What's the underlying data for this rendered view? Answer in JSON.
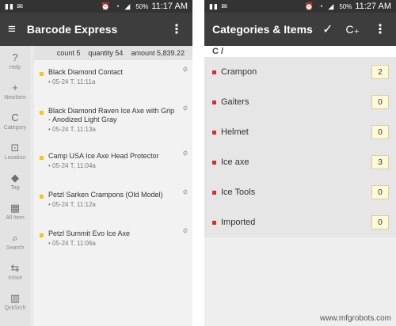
{
  "left": {
    "status": {
      "left_icons": "▮▮ ✉",
      "right_icons": "⏰ ◔ ◢",
      "battery": "50%",
      "time": "11:17 AM"
    },
    "appbar": {
      "title": "Barcode Express",
      "menu_icon": "≡",
      "overflow_icon": "⋮"
    },
    "sidebar": [
      {
        "label": "Help",
        "icon": "?"
      },
      {
        "label": "NewItem",
        "icon": "+"
      },
      {
        "label": "Category",
        "icon": "C"
      },
      {
        "label": "Location",
        "icon": "⊡"
      },
      {
        "label": "Tag",
        "icon": "◆"
      },
      {
        "label": "All Item",
        "icon": "▦"
      },
      {
        "label": "Search",
        "icon": "⌕"
      },
      {
        "label": "In/out",
        "icon": "⇆"
      },
      {
        "label": "QckSrch",
        "icon": "▥"
      }
    ],
    "summary": {
      "count": "count 5",
      "quantity": "quantity 54",
      "amount": "amount 5,839.22"
    },
    "items": [
      {
        "name": "Black Diamond Contact",
        "date": "• 05-24 T, 11:11a"
      },
      {
        "name": "Black Diamond Raven Ice Axe with Grip - Anodized Light Gray",
        "date": "• 05-24 T, 11:13a"
      },
      {
        "name": "Camp USA Ice Axe Head Protector",
        "date": "• 05-24 T, 11:04a"
      },
      {
        "name": "Petzl Sarken Crampons (Old Model)",
        "date": "• 05-24 T, 11:12a"
      },
      {
        "name": "Petzl Summit Evo Ice Axe",
        "date": "• 05-24 T, 11:06a"
      }
    ]
  },
  "right": {
    "status": {
      "left_icons": "▮▮ ✉",
      "right_icons": "⏰ ◔ ◢",
      "battery": "50%",
      "time": "11:27 AM"
    },
    "appbar": {
      "title": "Categories & Items",
      "check_icon": "✓",
      "addcat_icon": "C₊",
      "overflow_icon": "⋮"
    },
    "breadcrumb": "C /",
    "categories": [
      {
        "name": "Crampon",
        "count": "2"
      },
      {
        "name": "Gaiters",
        "count": "0"
      },
      {
        "name": "Helmet",
        "count": "0"
      },
      {
        "name": "Ice axe",
        "count": "3"
      },
      {
        "name": "Ice Tools",
        "count": "0"
      },
      {
        "name": "Imported",
        "count": "0"
      }
    ]
  },
  "watermark": "www.mfgrobots.com",
  "colors": {
    "appbar": "#3d3d3d",
    "statusbar": "#333333",
    "item_marker": "#f5c518",
    "category_marker": "#d32f2f",
    "count_badge": "#fff9d6"
  }
}
